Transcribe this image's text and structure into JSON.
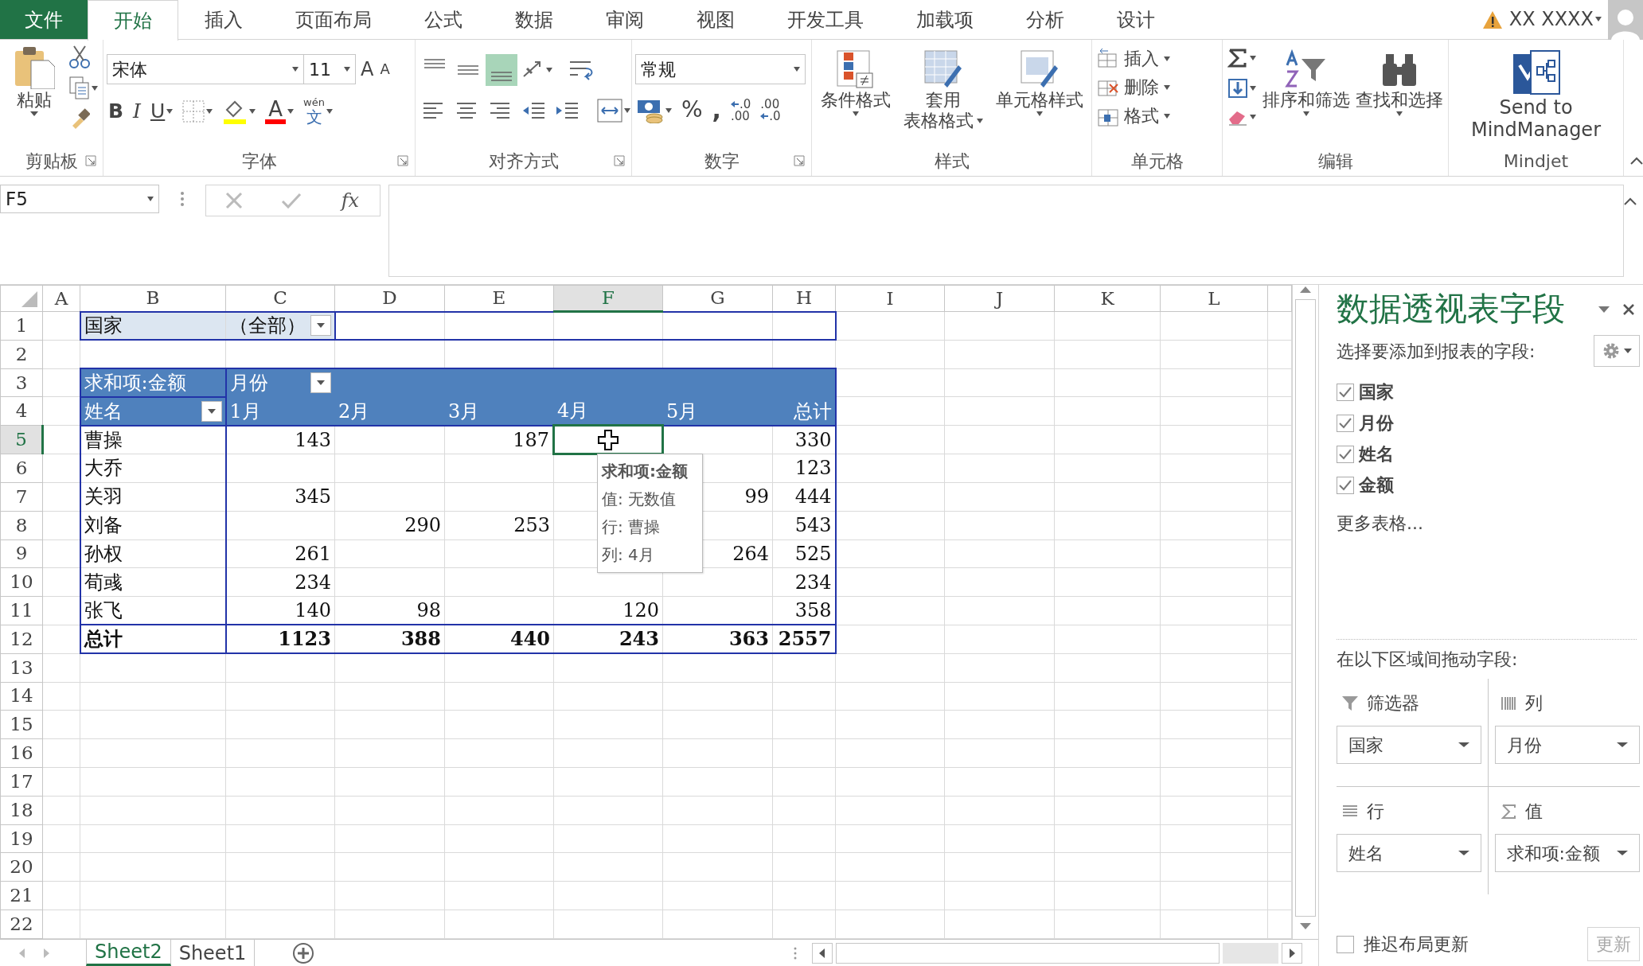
{
  "tabs": [
    {
      "label": "文件",
      "kind": "file",
      "selected": false
    },
    {
      "label": "开始",
      "kind": "tab",
      "selected": true
    },
    {
      "label": "插入",
      "kind": "tab",
      "selected": false
    },
    {
      "label": "页面布局",
      "kind": "tab",
      "selected": false
    },
    {
      "label": "公式",
      "kind": "tab",
      "selected": false
    },
    {
      "label": "数据",
      "kind": "tab",
      "selected": false
    },
    {
      "label": "审阅",
      "kind": "tab",
      "selected": false
    },
    {
      "label": "视图",
      "kind": "tab",
      "selected": false
    },
    {
      "label": "开发工具",
      "kind": "tab",
      "selected": false
    },
    {
      "label": "加载项",
      "kind": "tab",
      "selected": false
    },
    {
      "label": "分析",
      "kind": "tab",
      "selected": false
    },
    {
      "label": "设计",
      "kind": "tab",
      "selected": false
    }
  ],
  "account": {
    "name": "XX XXXX"
  },
  "ribbon": {
    "clipboard": {
      "label": "剪贴板",
      "paste": "粘贴"
    },
    "font": {
      "label": "字体",
      "font_name": "宋体",
      "font_size": "11",
      "grow": "A",
      "shrink": "A",
      "bold": "B",
      "italic": "I",
      "underline": "U",
      "font_color": "A",
      "phonetic_top": "wén",
      "phonetic_bottom": "文"
    },
    "alignment": {
      "label": "对齐方式",
      "vertical_align": [
        {
          "selected": false
        },
        {
          "selected": false
        },
        {
          "selected": true
        }
      ]
    },
    "number": {
      "label": "数字",
      "format": "常规",
      "percent": "%",
      "comma": ",",
      "increase_decimal": [
        ".0",
        ".00"
      ],
      "decrease_decimal": [
        ".00",
        ".0"
      ]
    },
    "styles": {
      "label": "样式",
      "buttons": [
        {
          "lines": [
            "条件格式"
          ]
        },
        {
          "lines": [
            "套用",
            "表格格式"
          ]
        },
        {
          "lines": [
            "单元格样式"
          ]
        }
      ]
    },
    "cells": {
      "label": "单元格",
      "buttons": [
        "插入",
        "删除",
        "格式"
      ]
    },
    "editing": {
      "label": "编辑",
      "buttons": [
        "排序和筛选",
        "查找和选择"
      ]
    },
    "mindjet": {
      "label": "Mindjet",
      "button": [
        "Send to",
        "MindManager"
      ]
    }
  },
  "formula_bar": {
    "name_box": "F5",
    "fx": "fx"
  },
  "sheet": {
    "columns": [
      {
        "label": "A",
        "selected": false
      },
      {
        "label": "B",
        "selected": false
      },
      {
        "label": "C",
        "selected": false
      },
      {
        "label": "D",
        "selected": false
      },
      {
        "label": "E",
        "selected": false
      },
      {
        "label": "F",
        "selected": true
      },
      {
        "label": "G",
        "selected": false
      },
      {
        "label": "H",
        "selected": false
      },
      {
        "label": "I",
        "selected": false
      },
      {
        "label": "J",
        "selected": false
      },
      {
        "label": "K",
        "selected": false
      },
      {
        "label": "L",
        "selected": false
      }
    ],
    "rows": [
      {
        "label": "1",
        "selected": false
      },
      {
        "label": "2",
        "selected": false
      },
      {
        "label": "3",
        "selected": false
      },
      {
        "label": "4",
        "selected": false
      },
      {
        "label": "5",
        "selected": true
      },
      {
        "label": "6",
        "selected": false
      },
      {
        "label": "7",
        "selected": false
      },
      {
        "label": "8",
        "selected": false
      },
      {
        "label": "9",
        "selected": false
      },
      {
        "label": "10",
        "selected": false
      },
      {
        "label": "11",
        "selected": false
      },
      {
        "label": "12",
        "selected": false
      },
      {
        "label": "13",
        "selected": false
      },
      {
        "label": "14",
        "selected": false
      },
      {
        "label": "15",
        "selected": false
      },
      {
        "label": "16",
        "selected": false
      },
      {
        "label": "17",
        "selected": false
      },
      {
        "label": "18",
        "selected": false
      },
      {
        "label": "19",
        "selected": false
      },
      {
        "label": "20",
        "selected": false
      },
      {
        "label": "21",
        "selected": false
      },
      {
        "label": "22",
        "selected": false
      }
    ]
  },
  "pivot": {
    "filter_field": "国家",
    "filter_value": "（全部）",
    "value_field": "求和项:金额",
    "column_field": "月份",
    "row_field": "姓名",
    "column_items": [
      "1月",
      "2月",
      "3月",
      "4月",
      "5月",
      "总计"
    ],
    "rows": [
      {
        "name": "曹操",
        "values": {
          "month_1": "143",
          "month_3": "187",
          "total": "330"
        }
      },
      {
        "name": "大乔",
        "values": {
          "total": "123"
        }
      },
      {
        "name": "关羽",
        "values": {
          "month_1": "345",
          "month_5": "99",
          "total": "444"
        }
      },
      {
        "name": "刘备",
        "values": {
          "month_2": "290",
          "month_3": "253",
          "total": "543"
        }
      },
      {
        "name": "孙权",
        "values": {
          "month_1": "261",
          "month_5": "264",
          "total": "525"
        }
      },
      {
        "name": "荀彧",
        "values": {
          "month_1": "234",
          "total": "234"
        }
      },
      {
        "name": "张飞",
        "values": {
          "month_1": "140",
          "month_2": "98",
          "month_4": "120",
          "total": "358"
        }
      }
    ],
    "total": {
      "name": "总计",
      "values": {
        "month_1": "1123",
        "month_2": "388",
        "month_3": "440",
        "month_4": "243",
        "month_5": "363",
        "total": "2557"
      }
    }
  },
  "tooltip": {
    "title": "求和项:金额",
    "lines": [
      "值: 无数值",
      "行: 曹操",
      "列: 4月"
    ]
  },
  "sheet_tabs": [
    {
      "label": "Sheet2",
      "selected": true
    },
    {
      "label": "Sheet1",
      "selected": false
    }
  ],
  "pivot_pane": {
    "title": "数据透视表字段",
    "prompt": "选择要添加到报表的字段:",
    "fields": [
      {
        "label": "国家",
        "checked": true
      },
      {
        "label": "月份",
        "checked": true
      },
      {
        "label": "姓名",
        "checked": true
      },
      {
        "label": "金额",
        "checked": true
      }
    ],
    "more_tables": "更多表格...",
    "areas_prompt": "在以下区域间拖动字段:",
    "areas": [
      {
        "kind": "filter",
        "label": "筛选器",
        "items": [
          "国家"
        ]
      },
      {
        "kind": "columns",
        "label": "列",
        "items": [
          "月份"
        ]
      },
      {
        "kind": "rows",
        "label": "行",
        "items": [
          "姓名"
        ]
      },
      {
        "kind": "values",
        "label": "值",
        "items": [
          "求和项:金额"
        ]
      }
    ],
    "defer": {
      "label": "推迟布局更新",
      "checked": false
    },
    "update": {
      "label": "更新",
      "disabled": true
    }
  }
}
